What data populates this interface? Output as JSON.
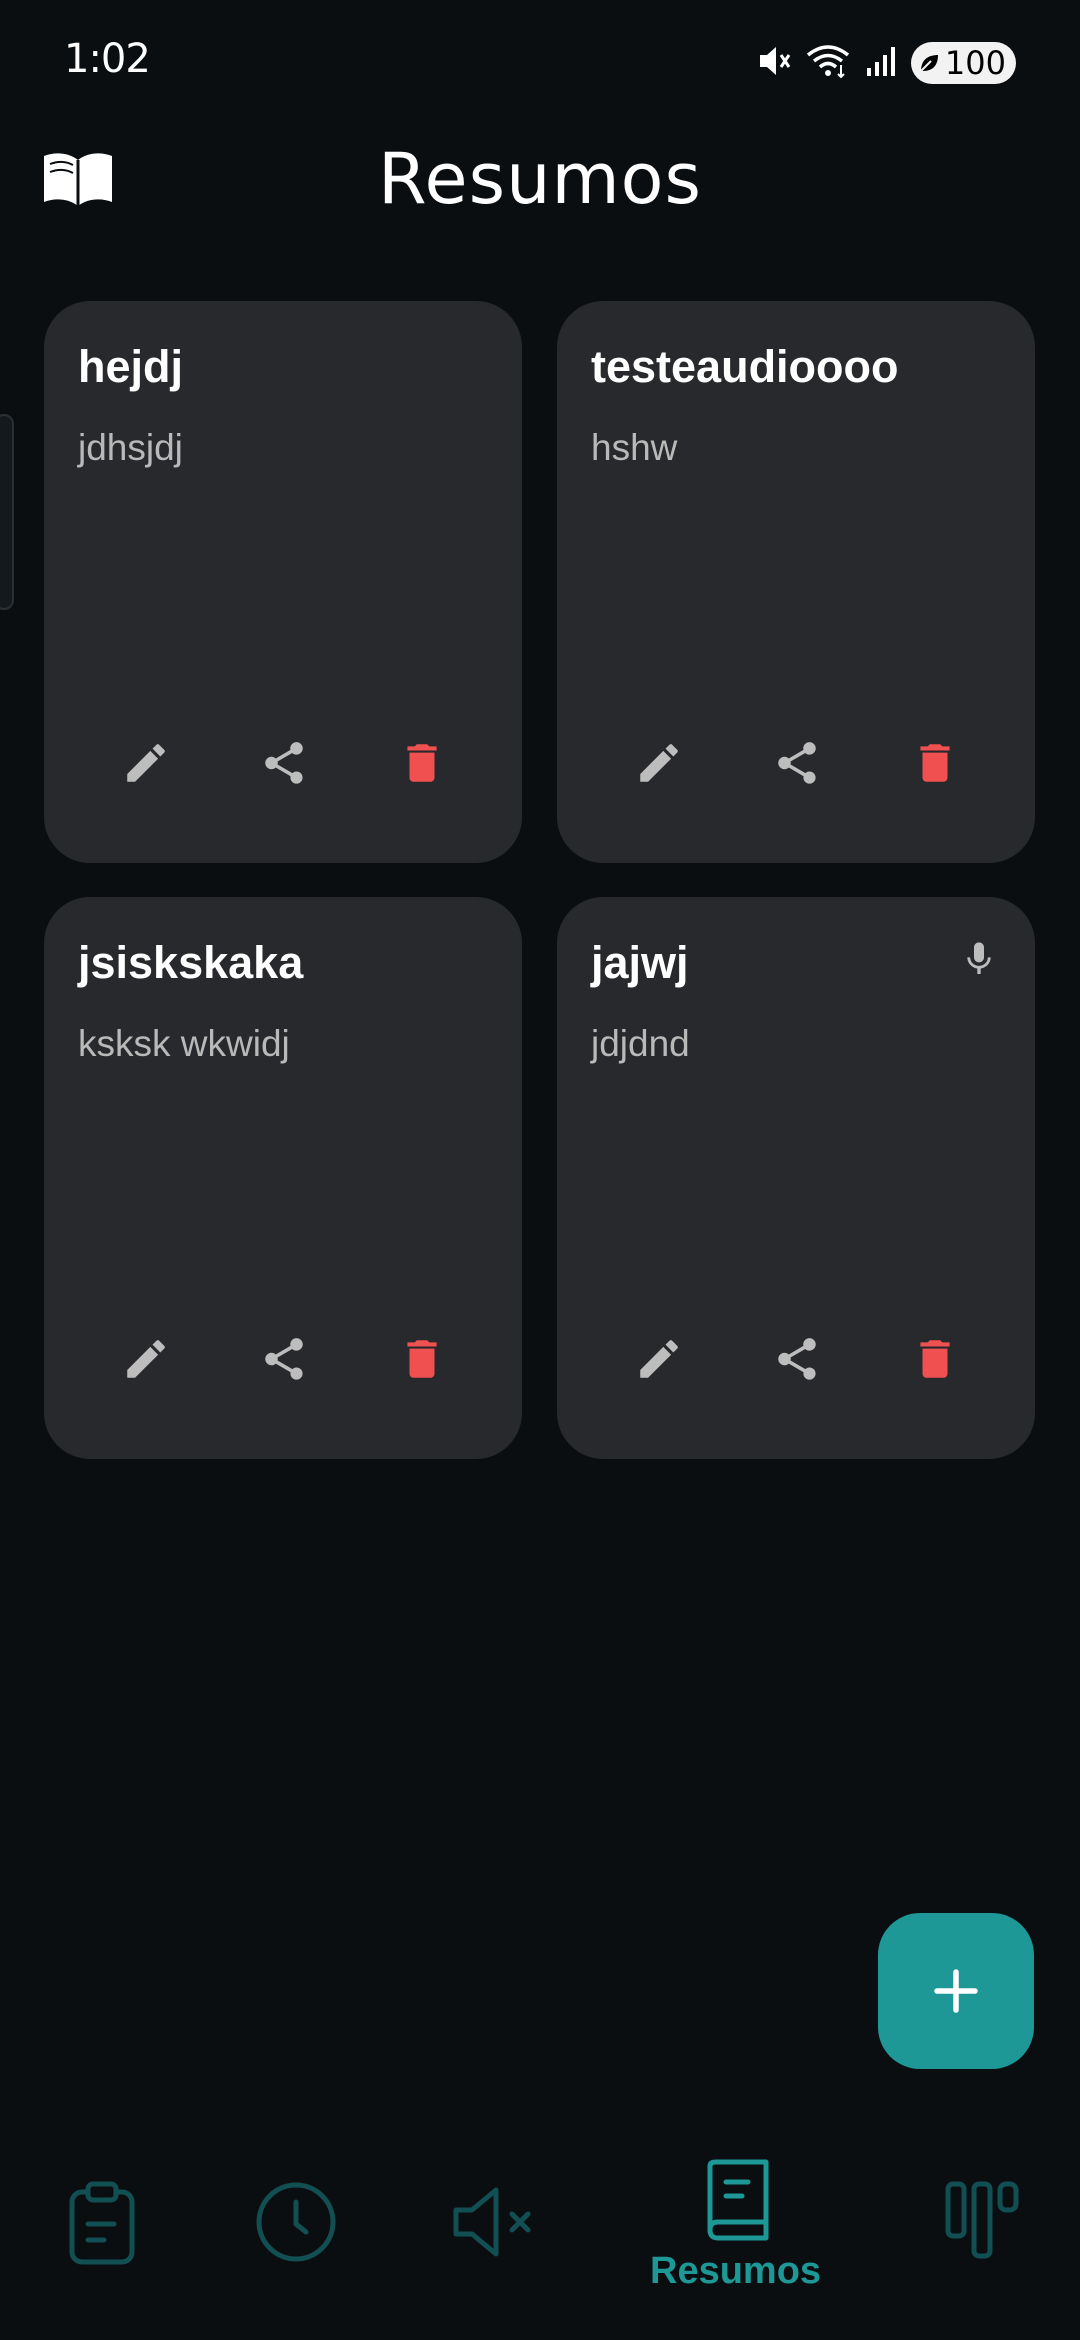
{
  "status_bar": {
    "time": "1:02",
    "battery_level": "100",
    "icons": [
      "mute-icon",
      "wifi-icon",
      "signal-icon",
      "battery-icon"
    ]
  },
  "header": {
    "title": "Resumos",
    "logo_icon": "open-book-icon"
  },
  "cards": [
    {
      "title": "hejdj",
      "body": "jdhsjdj",
      "has_audio": false
    },
    {
      "title": "testeaudioooo",
      "body": "hshw",
      "has_audio": false
    },
    {
      "title": "jsiskskaka",
      "body": "ksksk wkwidj",
      "has_audio": false
    },
    {
      "title": "jajwj",
      "body": "jdjdnd",
      "has_audio": true
    }
  ],
  "card_actions": [
    "edit-icon",
    "share-icon",
    "delete-icon"
  ],
  "fab": {
    "icon": "plus-icon"
  },
  "bottom_nav": {
    "items": [
      {
        "name": "clipboard",
        "icon": "clipboard-icon",
        "label": "",
        "active": false
      },
      {
        "name": "history",
        "icon": "clock-icon",
        "label": "",
        "active": false
      },
      {
        "name": "mute",
        "icon": "speaker-mute-icon",
        "label": "",
        "active": false
      },
      {
        "name": "resumos",
        "icon": "notebook-icon",
        "label": "Resumos",
        "active": true
      },
      {
        "name": "stats",
        "icon": "bars-icon",
        "label": "",
        "active": false
      }
    ]
  },
  "colors": {
    "background": "#0a0e11",
    "card": "#27292c",
    "accent": "#1d9896",
    "delete": "#f05050",
    "icon_muted": "#bdbdbd",
    "nav_inactive": "#124f52"
  }
}
